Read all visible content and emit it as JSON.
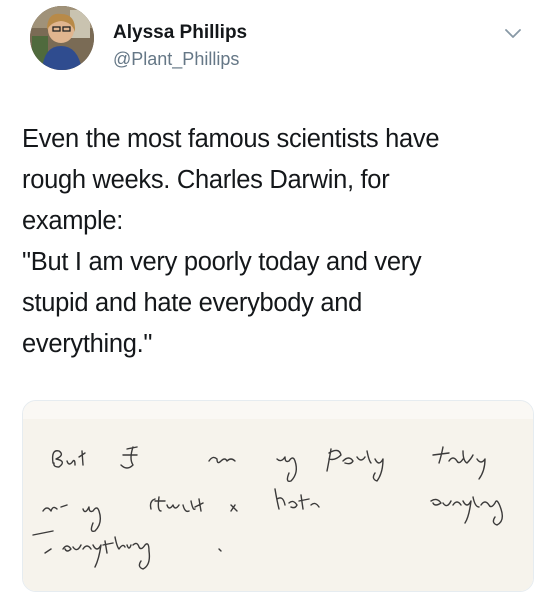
{
  "author": {
    "display_name": "Alyssa Phillips",
    "handle": "@Plant_Phillips"
  },
  "tweet": {
    "lines": [
      "Even the most famous scientists have",
      "rough weeks. Charles Darwin, for",
      "example:",
      "\"But I am very poorly today and very",
      "stupid and hate everybody and",
      "everything.\""
    ]
  },
  "media": {
    "handwriting": "But I am very poorly today and very stupid and hate everybody and everything."
  },
  "icons": {
    "menu": "chevron-down-icon"
  },
  "colors": {
    "name": "#14171a",
    "handle": "#657786",
    "text": "#14171a",
    "ink": "#3b3a3a",
    "paper": "#faf8f4"
  }
}
